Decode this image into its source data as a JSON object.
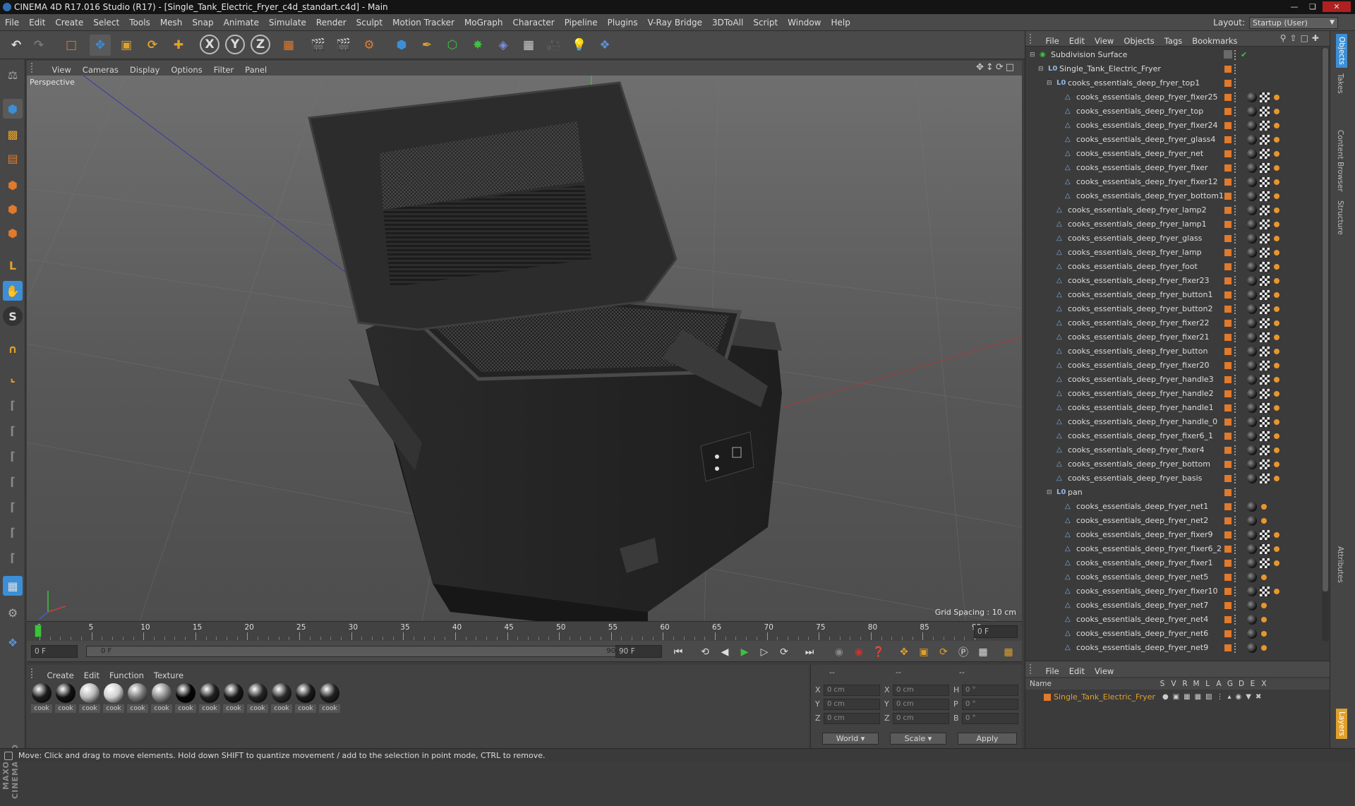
{
  "window": {
    "title": "CINEMA 4D R17.016 Studio (R17) - [Single_Tank_Electric_Fryer_c4d_standart.c4d] - Main"
  },
  "menubar": {
    "items": [
      "File",
      "Edit",
      "Create",
      "Select",
      "Tools",
      "Mesh",
      "Snap",
      "Animate",
      "Simulate",
      "Render",
      "Sculpt",
      "Motion Tracker",
      "MoGraph",
      "Character",
      "Pipeline",
      "Plugins",
      "V-Ray Bridge",
      "3DToAll",
      "Script",
      "Window",
      "Help"
    ],
    "layout_label": "Layout:",
    "layout_value": "Startup (User)"
  },
  "toolbar": {
    "axis_x": "X",
    "axis_y": "Y",
    "axis_z": "Z"
  },
  "viewport": {
    "menu": [
      "View",
      "Cameras",
      "Display",
      "Options",
      "Filter",
      "Panel"
    ],
    "label": "Perspective",
    "grid_spacing": "Grid Spacing : 10 cm"
  },
  "timeline": {
    "ticks": [
      "0",
      "5",
      "10",
      "15",
      "20",
      "25",
      "30",
      "35",
      "40",
      "45",
      "50",
      "55",
      "60",
      "65",
      "70",
      "75",
      "80",
      "85",
      "90"
    ],
    "current_frame": "0 F"
  },
  "transport": {
    "start_field": "0 F",
    "range_start": "0 F",
    "range_end": "90 F",
    "end_field": "90 F"
  },
  "materials": {
    "menu": [
      "Create",
      "Edit",
      "Function",
      "Texture"
    ],
    "items": [
      {
        "label": "cook",
        "color": "#1c1c1c"
      },
      {
        "label": "cook",
        "color": "#111111"
      },
      {
        "label": "cook",
        "color": "#b8b8b8"
      },
      {
        "label": "cook",
        "color": "#cfcfcf"
      },
      {
        "label": "cook",
        "color": "#7a7a7a"
      },
      {
        "label": "cook",
        "color": "#8a8a8a"
      },
      {
        "label": "cook",
        "color": "#050505"
      },
      {
        "label": "cook",
        "color": "#202020"
      },
      {
        "label": "cook",
        "color": "#181818"
      },
      {
        "label": "cook",
        "color": "#252525"
      },
      {
        "label": "cook",
        "color": "#2a2a2a"
      },
      {
        "label": "cook",
        "color": "#1a1a1a"
      },
      {
        "label": "cook",
        "color": "#222222"
      }
    ]
  },
  "coordinates": {
    "header_a": "--",
    "header_b": "--",
    "header_c": "--",
    "rows": [
      {
        "l1": "X",
        "v1": "0 cm",
        "l2": "X",
        "v2": "0 cm",
        "l3": "H",
        "v3": "0 °"
      },
      {
        "l1": "Y",
        "v1": "0 cm",
        "l2": "Y",
        "v2": "0 cm",
        "l3": "P",
        "v3": "0 °"
      },
      {
        "l1": "Z",
        "v1": "0 cm",
        "l2": "Z",
        "v2": "0 cm",
        "l3": "B",
        "v3": "0 °"
      }
    ],
    "space": "World",
    "mode": "Scale",
    "apply": "Apply"
  },
  "objects": {
    "menu": [
      "File",
      "Edit",
      "View",
      "Objects",
      "Tags",
      "Bookmarks"
    ],
    "rows": [
      {
        "name": "Subdivision Surface",
        "level": 0,
        "type": "subd",
        "tags": "check"
      },
      {
        "name": "Single_Tank_Electric_Fryer",
        "level": 1,
        "type": "null",
        "tags": ""
      },
      {
        "name": "cooks_essentials_deep_fryer_top1",
        "level": 2,
        "type": "null",
        "tags": ""
      },
      {
        "name": "cooks_essentials_deep_fryer_fixer25",
        "level": 3,
        "type": "poly",
        "tags": "bcd"
      },
      {
        "name": "cooks_essentials_deep_fryer_top",
        "level": 3,
        "type": "poly",
        "tags": "bcd"
      },
      {
        "name": "cooks_essentials_deep_fryer_fixer24",
        "level": 3,
        "type": "poly",
        "tags": "bcd"
      },
      {
        "name": "cooks_essentials_deep_fryer_glass4",
        "level": 3,
        "type": "poly",
        "tags": "bcd"
      },
      {
        "name": "cooks_essentials_deep_fryer_net",
        "level": 3,
        "type": "poly",
        "tags": "bcd"
      },
      {
        "name": "cooks_essentials_deep_fryer_fixer",
        "level": 3,
        "type": "poly",
        "tags": "bcd"
      },
      {
        "name": "cooks_essentials_deep_fryer_fixer12",
        "level": 3,
        "type": "poly",
        "tags": "bcd"
      },
      {
        "name": "cooks_essentials_deep_fryer_bottom1",
        "level": 3,
        "type": "poly",
        "tags": "bcd"
      },
      {
        "name": "cooks_essentials_deep_fryer_lamp2",
        "level": 2,
        "type": "poly",
        "tags": "bcd"
      },
      {
        "name": "cooks_essentials_deep_fryer_lamp1",
        "level": 2,
        "type": "poly",
        "tags": "bcd"
      },
      {
        "name": "cooks_essentials_deep_fryer_glass",
        "level": 2,
        "type": "poly",
        "tags": "bcd"
      },
      {
        "name": "cooks_essentials_deep_fryer_lamp",
        "level": 2,
        "type": "poly",
        "tags": "bcd"
      },
      {
        "name": "cooks_essentials_deep_fryer_foot",
        "level": 2,
        "type": "poly",
        "tags": "bcd"
      },
      {
        "name": "cooks_essentials_deep_fryer_fixer23",
        "level": 2,
        "type": "poly",
        "tags": "bcd"
      },
      {
        "name": "cooks_essentials_deep_fryer_button1",
        "level": 2,
        "type": "poly",
        "tags": "bcd"
      },
      {
        "name": "cooks_essentials_deep_fryer_button2",
        "level": 2,
        "type": "poly",
        "tags": "bcd"
      },
      {
        "name": "cooks_essentials_deep_fryer_fixer22",
        "level": 2,
        "type": "poly",
        "tags": "bcd"
      },
      {
        "name": "cooks_essentials_deep_fryer_fixer21",
        "level": 2,
        "type": "poly",
        "tags": "bcd"
      },
      {
        "name": "cooks_essentials_deep_fryer_button",
        "level": 2,
        "type": "poly",
        "tags": "bcd"
      },
      {
        "name": "cooks_essentials_deep_fryer_fixer20",
        "level": 2,
        "type": "poly",
        "tags": "bcd"
      },
      {
        "name": "cooks_essentials_deep_fryer_handle3",
        "level": 2,
        "type": "poly",
        "tags": "bcd"
      },
      {
        "name": "cooks_essentials_deep_fryer_handle2",
        "level": 2,
        "type": "poly",
        "tags": "bcd"
      },
      {
        "name": "cooks_essentials_deep_fryer_handle1",
        "level": 2,
        "type": "poly",
        "tags": "bcd"
      },
      {
        "name": "cooks_essentials_deep_fryer_handle_0",
        "level": 2,
        "type": "poly",
        "tags": "bcd"
      },
      {
        "name": "cooks_essentials_deep_fryer_fixer6_1",
        "level": 2,
        "type": "poly",
        "tags": "bcd"
      },
      {
        "name": "cooks_essentials_deep_fryer_fixer4",
        "level": 2,
        "type": "poly",
        "tags": "bcd"
      },
      {
        "name": "cooks_essentials_deep_fryer_bottom",
        "level": 2,
        "type": "poly",
        "tags": "bcd"
      },
      {
        "name": "cooks_essentials_deep_fryer_basis",
        "level": 2,
        "type": "poly",
        "tags": "bcd"
      },
      {
        "name": "pan",
        "level": 2,
        "type": "null",
        "tags": ""
      },
      {
        "name": "cooks_essentials_deep_fryer_net1",
        "level": 3,
        "type": "poly",
        "tags": "bd"
      },
      {
        "name": "cooks_essentials_deep_fryer_net2",
        "level": 3,
        "type": "poly",
        "tags": "bd"
      },
      {
        "name": "cooks_essentials_deep_fryer_fixer9",
        "level": 3,
        "type": "poly",
        "tags": "bcd"
      },
      {
        "name": "cooks_essentials_deep_fryer_fixer6_2",
        "level": 3,
        "type": "poly",
        "tags": "bcd"
      },
      {
        "name": "cooks_essentials_deep_fryer_fixer1",
        "level": 3,
        "type": "poly",
        "tags": "bcd"
      },
      {
        "name": "cooks_essentials_deep_fryer_net5",
        "level": 3,
        "type": "poly",
        "tags": "bd"
      },
      {
        "name": "cooks_essentials_deep_fryer_fixer10",
        "level": 3,
        "type": "poly",
        "tags": "bcd"
      },
      {
        "name": "cooks_essentials_deep_fryer_net7",
        "level": 3,
        "type": "poly",
        "tags": "bd"
      },
      {
        "name": "cooks_essentials_deep_fryer_net4",
        "level": 3,
        "type": "poly",
        "tags": "bd"
      },
      {
        "name": "cooks_essentials_deep_fryer_net6",
        "level": 3,
        "type": "poly",
        "tags": "bd"
      },
      {
        "name": "cooks_essentials_deep_fryer_net9",
        "level": 3,
        "type": "poly",
        "tags": "bd"
      }
    ]
  },
  "layers": {
    "menu": [
      "File",
      "Edit",
      "View"
    ],
    "col_name": "Name",
    "cols": [
      "S",
      "V",
      "R",
      "M",
      "L",
      "A",
      "G",
      "D",
      "E",
      "X"
    ],
    "row_name": "Single_Tank_Electric_Fryer"
  },
  "right_tabs": [
    "Objects",
    "Takes",
    "Content Browser",
    "Structure",
    "Attributes",
    "Layers"
  ],
  "status": "Move: Click and drag to move elements. Hold down SHIFT to quantize movement / add to the selection in point mode, CTRL to remove.",
  "brand": "MAXON CINEMA 4D",
  "colors": {
    "accent_orange": "#e07a2c",
    "accent_blue": "#3c8fd6",
    "play_green": "#3ec23e"
  }
}
